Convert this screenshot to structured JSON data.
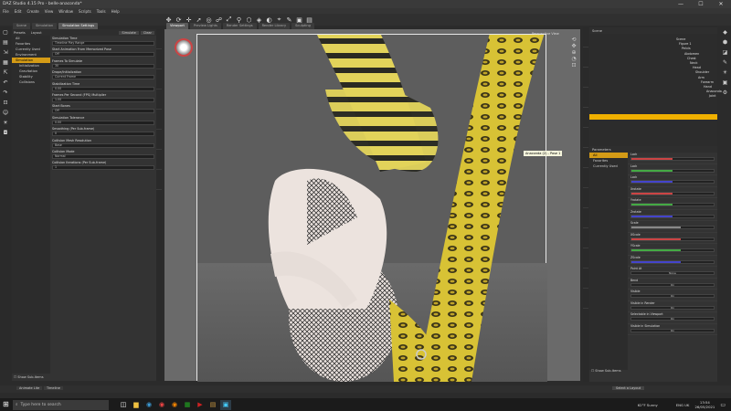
{
  "titlebar": {
    "title": "DAZ Studio 4.15 Pro - belle-anaconda*",
    "minimize": "—",
    "maximize": "☐",
    "close": "✕"
  },
  "menus": [
    "File",
    "Edit",
    "Create",
    "View",
    "Window",
    "Scripts",
    "Tools",
    "Help"
  ],
  "left_panel": {
    "tabs": [
      "Scene",
      "Simulation",
      "Simulation Settings"
    ],
    "subtabs": [
      "Presets",
      "Layout"
    ],
    "tools": [
      "Simulate",
      "Clear"
    ],
    "categories": [
      "All",
      "Favorites",
      "Currently Used",
      "Environment",
      "Simulation",
      "Initialization",
      "Gravitation",
      "Stability",
      "Collisions"
    ],
    "selected_category": "Simulation",
    "properties": [
      {
        "label": "Simulation Time",
        "value": "Timeline Play Range"
      },
      {
        "label": "Start Animation From Memorized Pose",
        "value": "Off"
      },
      {
        "label": "Frames To Simulate",
        "value": "30"
      },
      {
        "label": "Drape/Initialization",
        "value": "Current Frame"
      },
      {
        "label": "Stabilization Time",
        "value": "0.00"
      },
      {
        "label": "Frames Per Second (FPS) Multiplier",
        "value": "1.00"
      },
      {
        "label": "Start Bones",
        "value": "Off"
      },
      {
        "label": "Simulation Tolerance",
        "value": "0.00"
      },
      {
        "label": "Smoothing (Per Sub-frame)",
        "value": "0"
      },
      {
        "label": "Collision Mesh Resolution",
        "value": "Base"
      },
      {
        "label": "Collision Mode",
        "value": "Normal"
      },
      {
        "label": "Collision Iterations (Per Sub-frame)",
        "value": "1"
      }
    ],
    "show_sub_items": "Show Sub-Items",
    "bottom_tabs": [
      "Animate Lite",
      "Timeline"
    ]
  },
  "viewport": {
    "tabs": [
      "Viewport",
      "Preview Lights",
      "Render Settings",
      "Render Library",
      "Sculpting"
    ],
    "camera_label": "Perspective View",
    "tooltip": "Anaconda (2) - Pose 1"
  },
  "right_panel": {
    "tabs": [
      "Scene",
      "Parameters"
    ],
    "scene_items": [
      "Scene",
      "Figure 1",
      "Pelvis",
      "Abdomen",
      "Chest",
      "Neck",
      "Head",
      "Shoulder",
      "Arm",
      "Forearm",
      "Hand",
      "Anaconda",
      "Joint"
    ],
    "param_tabs": [
      "All",
      "Favorites",
      "Currently Used"
    ],
    "param_selected": "All",
    "params": [
      {
        "label": "Lock",
        "value": "0.00",
        "color": "#c44"
      },
      {
        "label": "Lock",
        "value": "0.00",
        "color": "#4a4"
      },
      {
        "label": "Lock",
        "value": "0.00",
        "color": "#44c"
      },
      {
        "label": "Xrotate",
        "value": "0.00",
        "color": "#c44"
      },
      {
        "label": "Yrotate",
        "value": "0.00",
        "color": "#4a4"
      },
      {
        "label": "Zrotate",
        "value": "0.00",
        "color": "#44c"
      },
      {
        "label": "Scale",
        "value": "100%",
        "color": "#888"
      },
      {
        "label": "XScale",
        "value": "100%",
        "color": "#c44"
      },
      {
        "label": "YScale",
        "value": "100%",
        "color": "#4a4"
      },
      {
        "label": "ZScale",
        "value": "100%",
        "color": "#44c"
      },
      {
        "label": "Point At",
        "value": "None",
        "color": "#666"
      },
      {
        "label": "Bend",
        "value": "On",
        "color": "#666"
      },
      {
        "label": "Visible",
        "value": "On",
        "color": "#666"
      },
      {
        "label": "Visible in Render",
        "value": "On",
        "color": "#666"
      },
      {
        "label": "Selectable in Viewport",
        "value": "On",
        "color": "#666"
      },
      {
        "label": "Visible in Simulation",
        "value": "On",
        "color": "#666"
      }
    ],
    "show_sub_items": "Show Sub-Items",
    "select_layout": "Select a Layout"
  },
  "taskbar": {
    "search": "Type here to search",
    "weather": "62°F  Sunny",
    "time": "13:54",
    "date": "26/05/2021",
    "lang": "ENG UK"
  }
}
